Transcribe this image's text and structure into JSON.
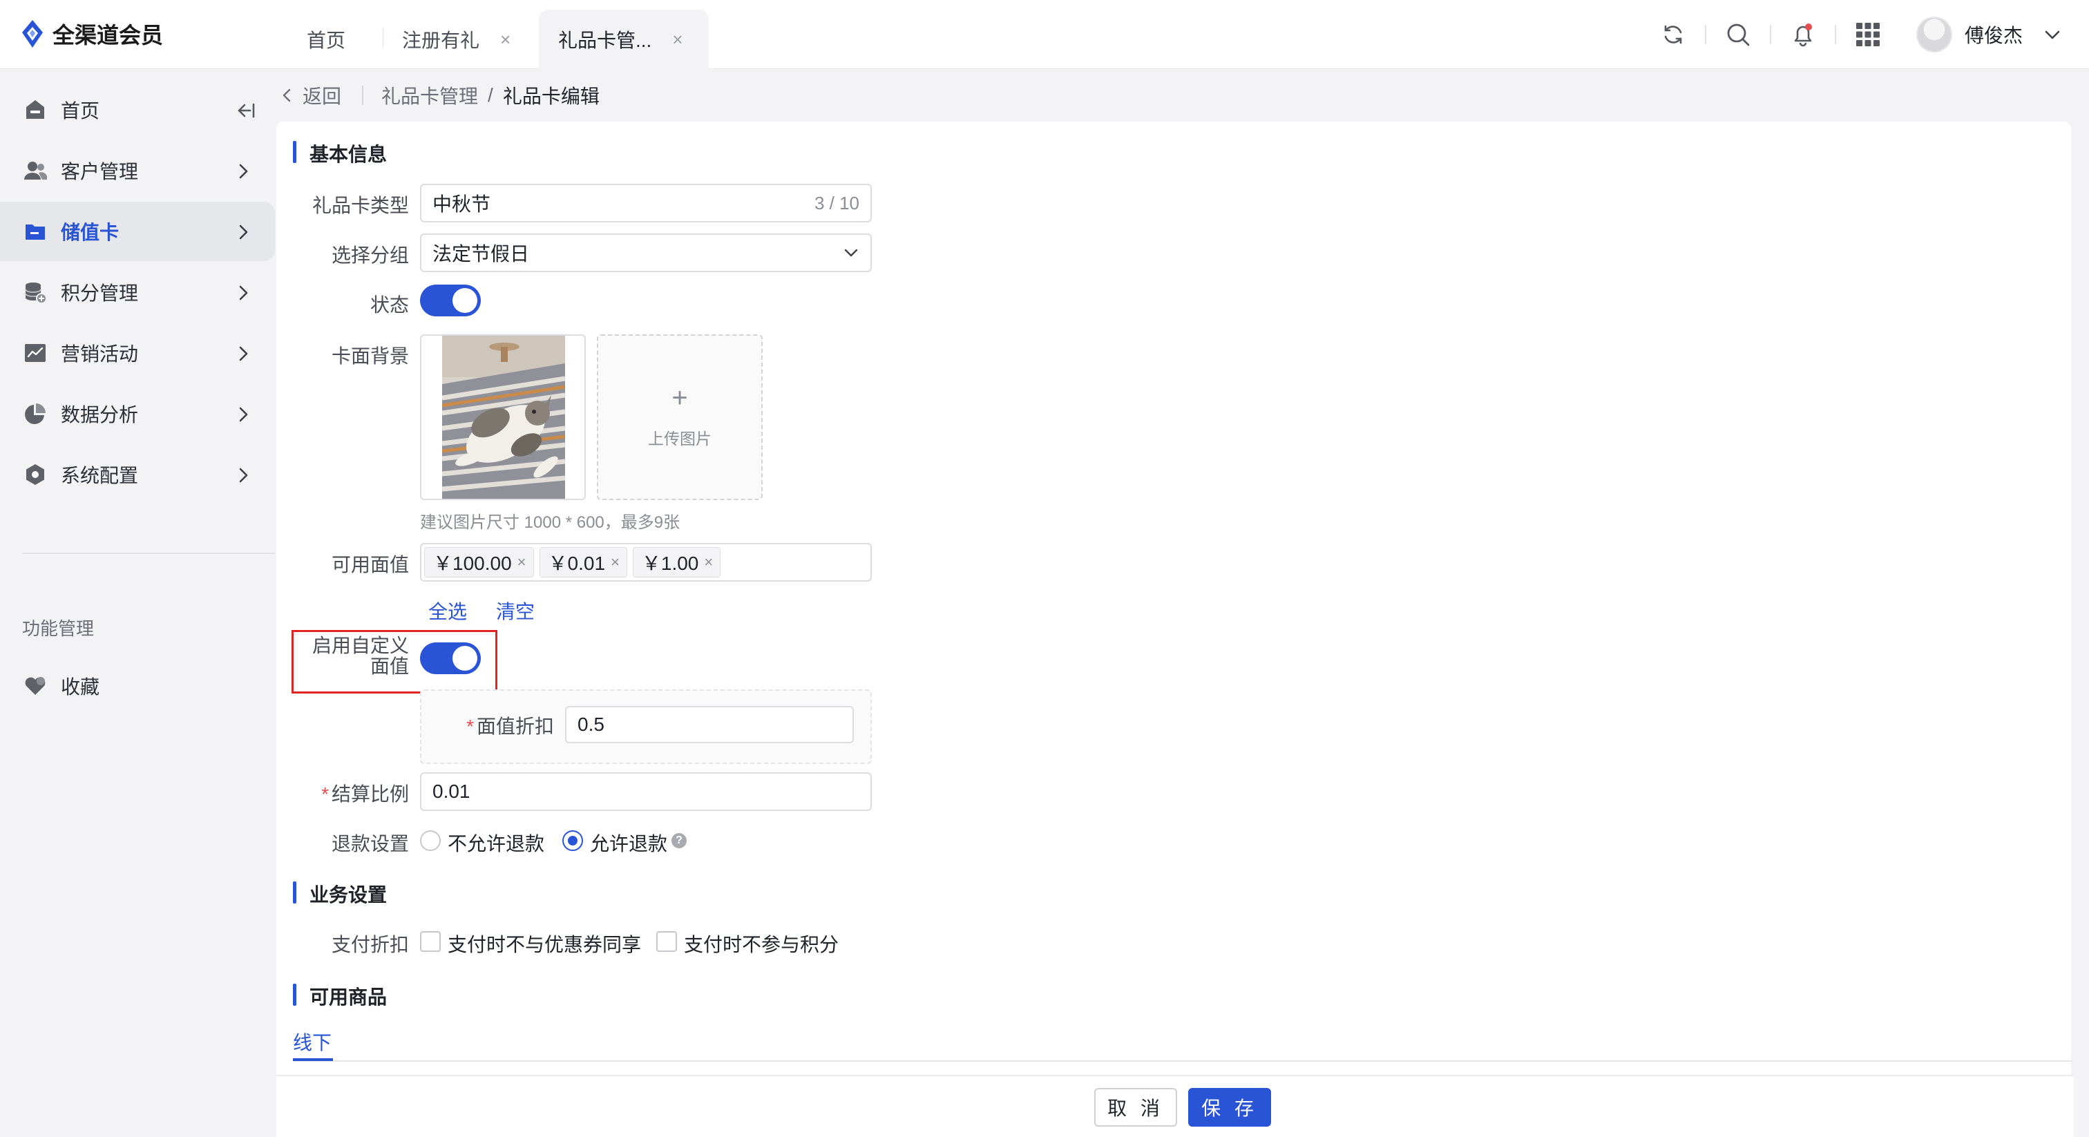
{
  "app": {
    "name": "全渠道会员"
  },
  "tabs": [
    {
      "label": "首页",
      "closable": false,
      "active": false
    },
    {
      "label": "注册有礼",
      "closable": true,
      "active": false
    },
    {
      "label": "礼品卡管...",
      "closable": true,
      "active": true
    }
  ],
  "tab_close_glyph": "×",
  "user": {
    "name": "傅俊杰"
  },
  "sidebar": {
    "items": [
      {
        "label": "首页",
        "icon": "home-icon"
      },
      {
        "label": "客户管理",
        "icon": "users-icon"
      },
      {
        "label": "储值卡",
        "icon": "card-icon",
        "active": true
      },
      {
        "label": "积分管理",
        "icon": "coins-icon"
      },
      {
        "label": "营销活动",
        "icon": "chart-line-icon"
      },
      {
        "label": "数据分析",
        "icon": "pie-chart-icon"
      },
      {
        "label": "系统配置",
        "icon": "hexagon-settings-icon"
      }
    ],
    "group_label": "功能管理",
    "favorite_label": "收藏"
  },
  "breadcrumb": {
    "back": "返回",
    "parent": "礼品卡管理",
    "separator": "/",
    "current": "礼品卡编辑"
  },
  "sections": {
    "basic": "基本信息",
    "business": "业务设置",
    "products": "可用商品"
  },
  "form": {
    "card_type": {
      "label": "礼品卡类型",
      "value": "中秋节",
      "counter": "3 / 10"
    },
    "group": {
      "label": "选择分组",
      "value": "法定节假日"
    },
    "status": {
      "label": "状态",
      "enabled": true
    },
    "background": {
      "label": "卡面背景",
      "upload_plus": "+",
      "upload_text": "上传图片",
      "hint": "建议图片尺寸 1000 * 600，最多9张"
    },
    "face_values": {
      "label": "可用面值",
      "tags": [
        "￥100.00",
        "￥0.01",
        "￥1.00"
      ],
      "tag_close": "×",
      "select_all": "全选",
      "clear": "清空"
    },
    "custom_value": {
      "label_line1": "启用自定义",
      "label_line2": "面值",
      "enabled": true
    },
    "discount": {
      "label": "面值折扣",
      "value": "0.5",
      "required_mark": "*"
    },
    "settlement": {
      "label": "结算比例",
      "value": "0.01",
      "required_mark": "*"
    },
    "refund": {
      "label": "退款设置",
      "options": [
        {
          "label": "不允许退款",
          "selected": false
        },
        {
          "label": "允许退款",
          "selected": true
        }
      ],
      "help": "?"
    },
    "pay_discount": {
      "label": "支付折扣",
      "options": [
        {
          "label": "支付时不与优惠券同享",
          "checked": false
        },
        {
          "label": "支付时不参与积分",
          "checked": false
        }
      ]
    },
    "product_tab": "线下"
  },
  "footer": {
    "cancel": "取 消",
    "save": "保 存"
  },
  "colors": {
    "accent": "#2a54d6",
    "highlight": "#e02525",
    "notification": "#e34d4d"
  }
}
